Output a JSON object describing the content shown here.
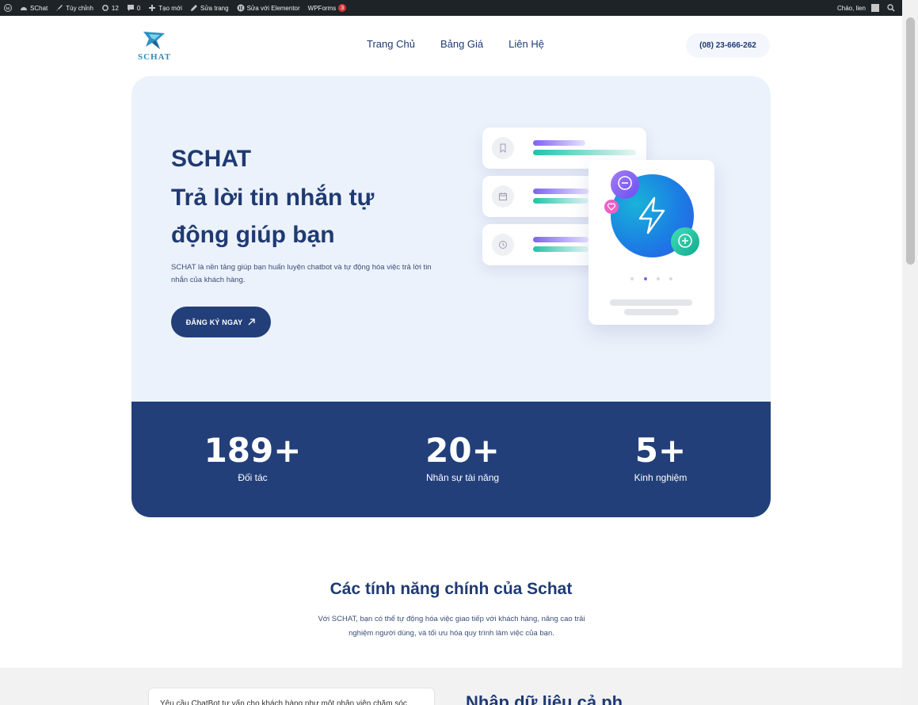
{
  "admin_bar": {
    "items": [
      {
        "icon": "wordpress-icon",
        "label": ""
      },
      {
        "icon": "dashboard-icon",
        "label": "SChat"
      },
      {
        "icon": "brush-icon",
        "label": "Tùy chỉnh"
      },
      {
        "icon": "update-icon",
        "label": "12"
      },
      {
        "icon": "comment-icon",
        "label": "0"
      },
      {
        "icon": "plus-icon",
        "label": "Tạo mới"
      },
      {
        "icon": "pencil-icon",
        "label": "Sửa trang"
      },
      {
        "icon": "elementor-icon",
        "label": "Sửa với Elementor"
      },
      {
        "icon": "",
        "label": "WPForms"
      }
    ],
    "wpforms_badge": "3",
    "greeting": "Chào, lien"
  },
  "header": {
    "logo_text": "SCHAT",
    "nav": [
      "Trang Chủ",
      "Bảng Giá",
      "Liên Hệ"
    ],
    "phone": "(08) 23-666-262"
  },
  "hero": {
    "brand": "SCHAT",
    "title": "Trả lời tin nhắn tự động giúp bạn",
    "description": "SCHAT là nền tảng giúp bạn huấn luyện chatbot và tự động hóa việc trả lời tin nhắn của khách hàng.",
    "cta_label": "ĐĂNG KÝ NGAY"
  },
  "stats": [
    {
      "number": "189+",
      "label": "Đối tác"
    },
    {
      "number": "20+",
      "label": "Nhân sự tài năng"
    },
    {
      "number": "5+",
      "label": "Kinh nghiệm"
    }
  ],
  "features": {
    "title": "Các tính năng chính của Schat",
    "description": "Với SCHAT, bạn có thể tự động hóa việc giao tiếp với khách hàng, nâng cao trải nghiệm người dùng, và tối ưu hóa quy trình làm việc của bạn."
  },
  "next_section": {
    "chat_prompt": "Yêu cầu ChatBot tư vấn cho khách hàng như một nhân viên chăm sóc",
    "heading": "Nhập dữ liệu cả ph"
  },
  "colors": {
    "primary": "#223f7a",
    "hero_bg": "#ecf2fb",
    "accent_purple": "#7c63f2",
    "accent_teal": "#1fc3a8"
  }
}
